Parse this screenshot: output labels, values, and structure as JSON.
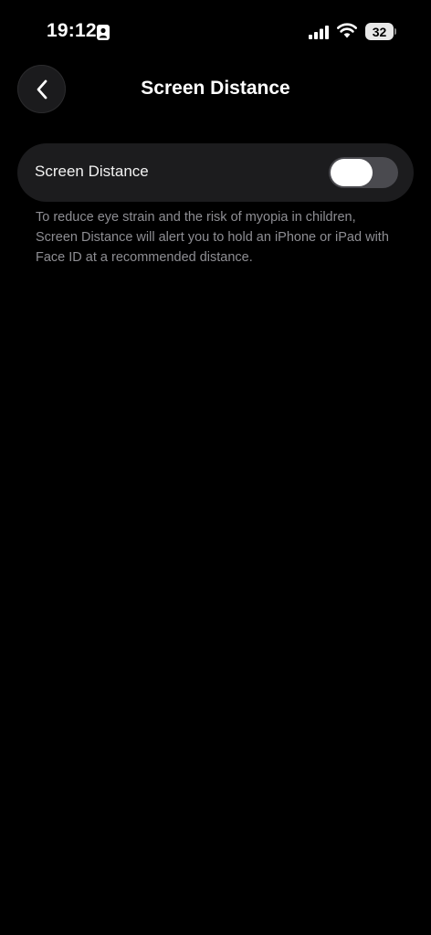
{
  "status_bar": {
    "time": "19:12",
    "battery_level": "32"
  },
  "nav": {
    "title": "Screen Distance"
  },
  "setting": {
    "label": "Screen Distance",
    "enabled": true
  },
  "footer": {
    "description": "To reduce eye strain and the risk of myopia in children, Screen Distance will alert you to hold an iPhone or iPad with Face ID at a recommended distance."
  }
}
